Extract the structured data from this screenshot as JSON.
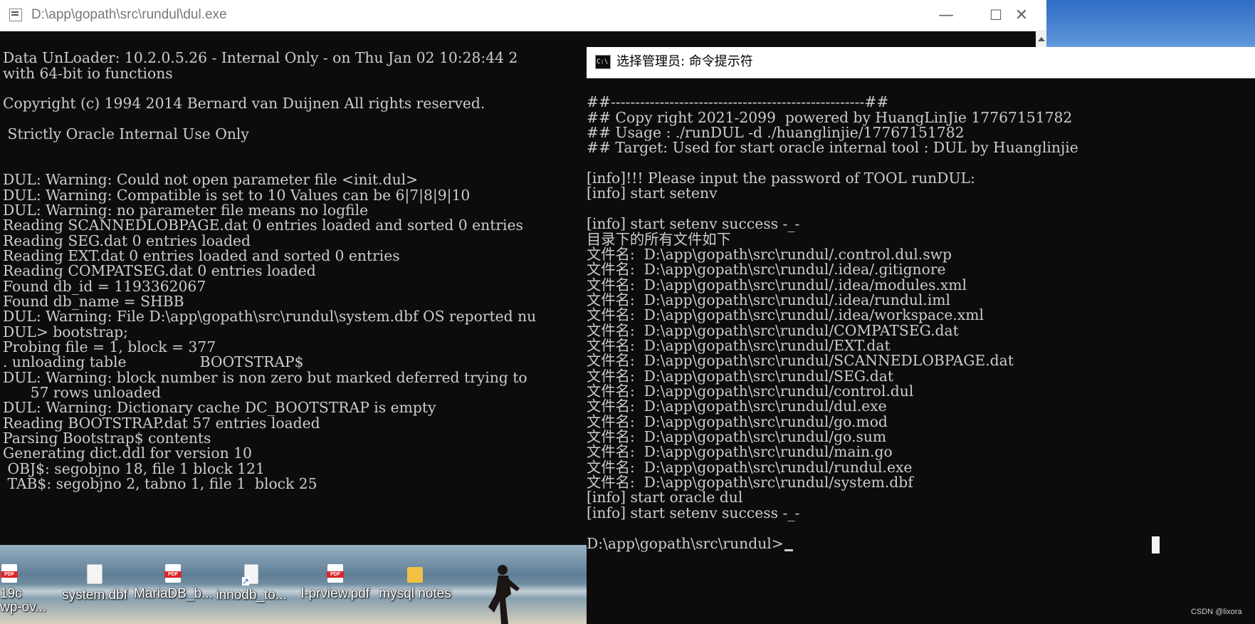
{
  "desktop": {
    "icons": [
      {
        "label": "19c",
        "label2": "wp-ov...",
        "icon": "pdf-file-icon",
        "type": "pdf"
      },
      {
        "label": "system.dbf",
        "icon": "file-icon",
        "type": "doc"
      },
      {
        "label": "MariaDB_b...",
        "icon": "pdf-file-icon",
        "type": "pdf"
      },
      {
        "label": "innodb_to...",
        "icon": "shortcut-file-icon",
        "type": "shortcut"
      },
      {
        "label": "l-prview.pdf",
        "icon": "pdf-file-icon",
        "type": "pdf"
      },
      {
        "label": "mysql notes",
        "icon": "folder-icon",
        "type": "folder"
      }
    ],
    "watermark": "CSDN @lixora"
  },
  "window1": {
    "title": "D:\\app\\gopath\\src\\rundul\\dul.exe",
    "buttons": {
      "minimize": "—",
      "maximize": "☐",
      "close": "✕"
    },
    "lines": [
      "",
      "Data UnLoader: 10.2.0.5.26 - Internal Only - on Thu Jan 02 10:28:44 2",
      "with 64-bit io functions",
      "",
      "Copyright (c) 1994 2014 Bernard van Duijnen All rights reserved.",
      "",
      " Strictly Oracle Internal Use Only",
      "",
      "",
      "DUL: Warning: Could not open parameter file <init.dul>",
      "DUL: Warning: Compatible is set to 10 Values can be 6|7|8|9|10",
      "DUL: Warning: no parameter file means no logfile",
      "Reading SCANNEDLOBPAGE.dat 0 entries loaded and sorted 0 entries",
      "Reading SEG.dat 0 entries loaded",
      "Reading EXT.dat 0 entries loaded and sorted 0 entries",
      "Reading COMPATSEG.dat 0 entries loaded",
      "Found db_id = 1193362067",
      "Found db_name = SHBB",
      "DUL: Warning: File D:\\app\\gopath\\src\\rundul\\system.dbf OS reported nu",
      "DUL> bootstrap;",
      "Probing file = 1, block = 377",
      ". unloading table                BOOTSTRAP$",
      "DUL: Warning: block number is non zero but marked deferred trying to",
      "      57 rows unloaded",
      "DUL: Warning: Dictionary cache DC_BOOTSTRAP is empty",
      "Reading BOOTSTRAP.dat 57 entries loaded",
      "Parsing Bootstrap$ contents",
      "Generating dict.ddl for version 10",
      " OBJ$: segobjno 18, file 1 block 121",
      " TAB$: segobjno 2, tabno 1, file 1  block 25"
    ]
  },
  "window2": {
    "title": "选择管理员: 命令提示符",
    "icon_text": "C:\\",
    "lines": [
      "",
      "##----------------------------------------------------##",
      "## Copy right 2021-2099  powered by HuangLinJie 17767151782",
      "## Usage : ./runDUL -d ./huanglinjie/17767151782",
      "## Target: Used for start oracle internal tool : DUL by Huanglinjie",
      "",
      "[info]!!! Please input the password of TOOL runDUL:",
      "[info] start setenv",
      "",
      "[info] start setenv success -_-",
      "目录下的所有文件如下",
      "文件名:  D:\\app\\gopath\\src\\rundul/.control.dul.swp",
      "文件名:  D:\\app\\gopath\\src\\rundul/.idea/.gitignore",
      "文件名:  D:\\app\\gopath\\src\\rundul/.idea/modules.xml",
      "文件名:  D:\\app\\gopath\\src\\rundul/.idea/rundul.iml",
      "文件名:  D:\\app\\gopath\\src\\rundul/.idea/workspace.xml",
      "文件名:  D:\\app\\gopath\\src\\rundul/COMPATSEG.dat",
      "文件名:  D:\\app\\gopath\\src\\rundul/EXT.dat",
      "文件名:  D:\\app\\gopath\\src\\rundul/SCANNEDLOBPAGE.dat",
      "文件名:  D:\\app\\gopath\\src\\rundul/SEG.dat",
      "文件名:  D:\\app\\gopath\\src\\rundul/control.dul",
      "文件名:  D:\\app\\gopath\\src\\rundul/dul.exe",
      "文件名:  D:\\app\\gopath\\src\\rundul/go.mod",
      "文件名:  D:\\app\\gopath\\src\\rundul/go.sum",
      "文件名:  D:\\app\\gopath\\src\\rundul/main.go",
      "文件名:  D:\\app\\gopath\\src\\rundul/rundul.exe",
      "文件名:  D:\\app\\gopath\\src\\rundul/system.dbf",
      "[info] start oracle dul",
      "[info] start setenv success -_-",
      ""
    ],
    "prompt": "D:\\app\\gopath\\src\\rundul>"
  }
}
